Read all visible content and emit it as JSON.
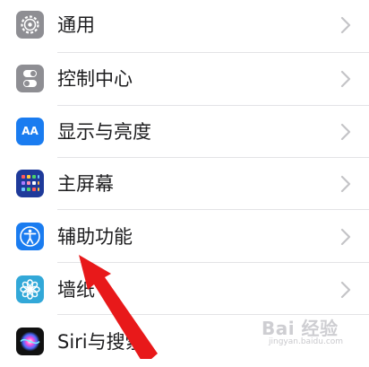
{
  "settings": {
    "items": [
      {
        "label": "通用",
        "icon": "gear-icon"
      },
      {
        "label": "控制中心",
        "icon": "toggles-icon"
      },
      {
        "label": "显示与亮度",
        "icon": "text-size-icon",
        "icon_text": "AA"
      },
      {
        "label": "主屏幕",
        "icon": "app-grid-icon"
      },
      {
        "label": "辅助功能",
        "icon": "accessibility-icon"
      },
      {
        "label": "墙纸",
        "icon": "flower-icon"
      },
      {
        "label": "Siri与搜索",
        "icon": "siri-icon"
      }
    ]
  },
  "watermark": {
    "brand": "Bai 经验",
    "url": "jingyan.baidu.com"
  },
  "colors": {
    "gray_icon": "#8e8e93",
    "blue_icon": "#1a7cf0",
    "navy_icon": "#1e3a9a",
    "teal_icon": "#32a8d8",
    "annotation_arrow": "#e8191a"
  }
}
